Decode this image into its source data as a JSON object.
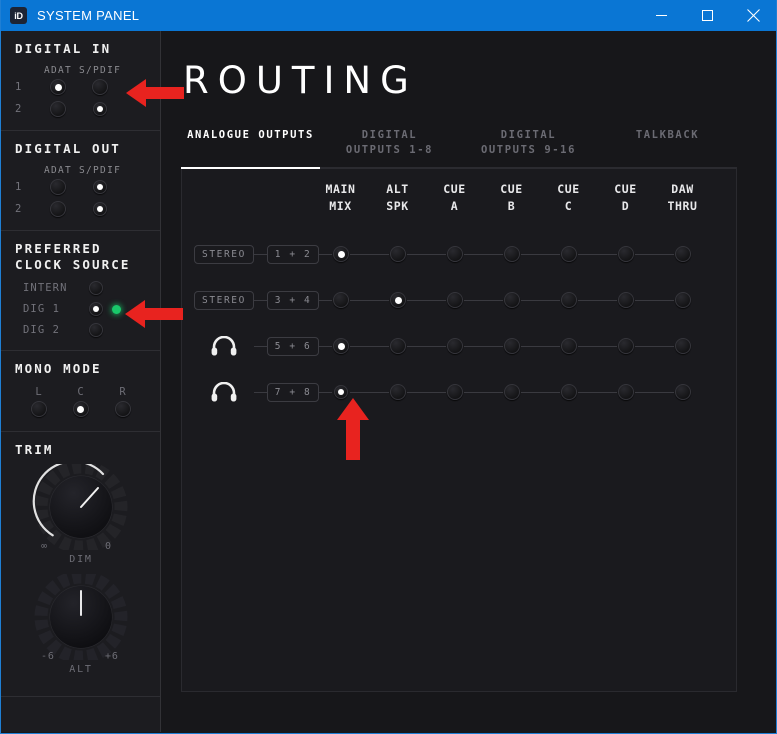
{
  "window": {
    "app_icon_text": "iD",
    "title": "SYSTEM PANEL",
    "minimize_label": "minimize-icon",
    "maximize_label": "maximize-icon",
    "close_label": "close-icon",
    "titlebar_color": "#0a76d4"
  },
  "sidebar": {
    "digital_in": {
      "title": "DIGITAL IN",
      "columns": [
        "ADAT",
        "S/PDIF"
      ],
      "rows": [
        {
          "label": "1",
          "adat": true,
          "spdif": false
        },
        {
          "label": "2",
          "adat": false,
          "spdif": true
        }
      ]
    },
    "digital_out": {
      "title": "DIGITAL OUT",
      "columns": [
        "ADAT",
        "S/PDIF"
      ],
      "rows": [
        {
          "label": "1",
          "adat": false,
          "spdif": true
        },
        {
          "label": "2",
          "adat": false,
          "spdif": true
        }
      ]
    },
    "clock_source": {
      "title_line1": "PREFERRED",
      "title_line2": "CLOCK SOURCE",
      "options": [
        {
          "label": "INTERN",
          "selected": false,
          "led": false
        },
        {
          "label": "DIG 1",
          "selected": true,
          "led": true
        },
        {
          "label": "DIG 2",
          "selected": false,
          "led": false
        }
      ],
      "led_color": "#19c86a"
    },
    "mono_mode": {
      "title": "MONO MODE",
      "options": [
        {
          "label": "L",
          "selected": false
        },
        {
          "label": "C",
          "selected": true
        },
        {
          "label": "R",
          "selected": false
        }
      ]
    },
    "trim": {
      "title": "TRIM",
      "knobs": [
        {
          "name": "DIM",
          "min_label": "∞",
          "max_label": "0",
          "angle": 48,
          "arc": true
        },
        {
          "name": "ALT",
          "min_label": "-6",
          "max_label": "+6",
          "angle": 0,
          "arc": false
        }
      ]
    }
  },
  "main": {
    "page_title": "ROUTING",
    "tabs": [
      {
        "line1": "ANALOGUE OUTPUTS",
        "line2": "",
        "active": true
      },
      {
        "line1": "DIGITAL",
        "line2": "OUTPUTS 1-8",
        "active": false
      },
      {
        "line1": "DIGITAL",
        "line2": "OUTPUTS 9-16",
        "active": false
      },
      {
        "line1": "TALKBACK",
        "line2": "",
        "active": false
      }
    ],
    "grid": {
      "columns": [
        {
          "line1": "MAIN",
          "line2": "MIX"
        },
        {
          "line1": "ALT",
          "line2": "SPK"
        },
        {
          "line1": "CUE",
          "line2": "A"
        },
        {
          "line1": "CUE",
          "line2": "B"
        },
        {
          "line1": "CUE",
          "line2": "C"
        },
        {
          "line1": "CUE",
          "line2": "D"
        },
        {
          "line1": "DAW",
          "line2": "THRU"
        }
      ],
      "rows": [
        {
          "type": "STEREO",
          "icon": "",
          "pair": "1 + 2",
          "selected": 0
        },
        {
          "type": "STEREO",
          "icon": "",
          "pair": "3 + 4",
          "selected": 1
        },
        {
          "type": "",
          "icon": "headphone-icon",
          "pair": "5 + 6",
          "selected": 0
        },
        {
          "type": "",
          "icon": "headphone-icon",
          "pair": "7 + 8",
          "selected": 0
        }
      ]
    }
  },
  "annotations": {
    "arrow_color": "#e8231f",
    "arrows": [
      {
        "name": "arrow-digital-in",
        "direction": "left"
      },
      {
        "name": "arrow-clock-dig1",
        "direction": "left"
      },
      {
        "name": "arrow-row4-main-mix",
        "direction": "up"
      }
    ]
  }
}
